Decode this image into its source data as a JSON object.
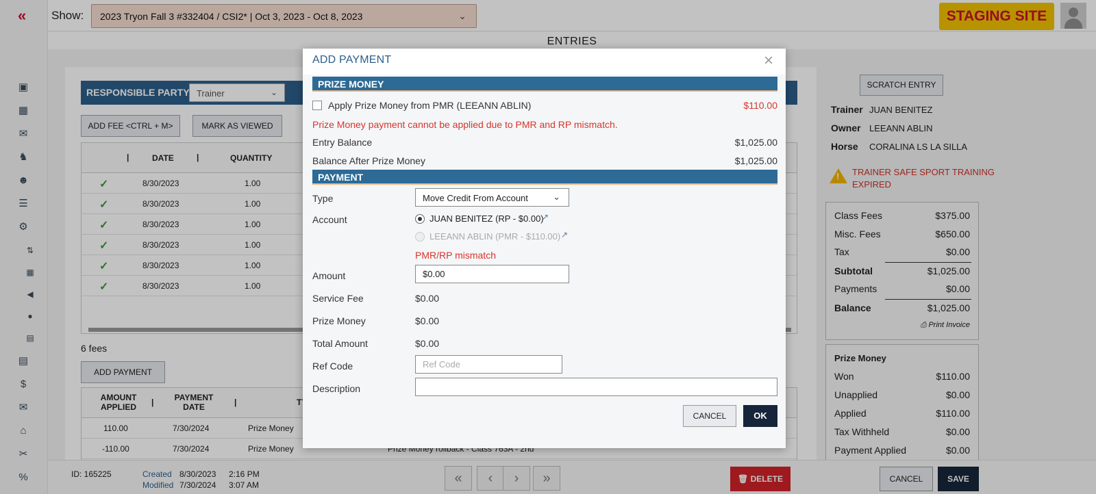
{
  "topbar": {
    "show_label": "Show:",
    "show_value": "2023 Tryon Fall 3 #332404 / CSI2* | Oct 3, 2023 - Oct 8, 2023",
    "staging_label": "STAGING SITE"
  },
  "page": {
    "title": "ENTRIES"
  },
  "background": {
    "rp_label": "RESPONSIBLE PARTY",
    "rp_select": "Trainer",
    "add_fee_button": "ADD FEE <CTRL + M>",
    "mark_viewed_button": "MARK AS VIEWED",
    "grid_headers": [
      "DATE",
      "QUANTITY"
    ],
    "grid_rows": [
      {
        "date": "8/30/2023",
        "qty": "1.00"
      },
      {
        "date": "8/30/2023",
        "qty": "1.00"
      },
      {
        "date": "8/30/2023",
        "qty": "1.00"
      },
      {
        "date": "8/30/2023",
        "qty": "1.00"
      },
      {
        "date": "8/30/2023",
        "qty": "1.00"
      },
      {
        "date": "8/30/2023",
        "qty": "1.00"
      }
    ],
    "fees_count": "6 fees",
    "add_payment_button": "ADD PAYMENT",
    "pay_headers": [
      "AMOUNT APPLIED",
      "PAYMENT DATE",
      "TY"
    ],
    "pay_rows": [
      {
        "amount": "110.00",
        "date": "7/30/2024",
        "type": "Prize Money",
        "desc": ""
      },
      {
        "amount": "-110.00",
        "date": "7/30/2024",
        "type": "Prize Money",
        "desc": "Prize Money rollback - Class 763A - 2nd"
      }
    ],
    "scratch_button": "SCRATCH ENTRY",
    "trainer_label": "Trainer",
    "trainer_value": "JUAN BENITEZ",
    "owner_label": "Owner",
    "owner_value": "LEEANN ABLIN",
    "horse_label": "Horse",
    "horse_value": "CORALINA LS LA SILLA",
    "warning": "TRAINER SAFE SPORT TRAINING EXPIRED",
    "fees_box": [
      {
        "label": "Class Fees",
        "value": "$375.00"
      },
      {
        "label": "Misc. Fees",
        "value": "$650.00"
      },
      {
        "label": "Tax",
        "value": "$0.00"
      },
      {
        "label": "Subtotal",
        "value": "$1,025.00"
      },
      {
        "label": "Payments",
        "value": "$0.00"
      },
      {
        "label": "Balance",
        "value": "$1,025.00"
      }
    ],
    "print_invoice": "Print Invoice",
    "prize_box_title": "Prize Money",
    "prize_box": [
      {
        "label": "Won",
        "value": "$110.00"
      },
      {
        "label": "Unapplied",
        "value": "$0.00"
      },
      {
        "label": "Applied",
        "value": "$110.00"
      },
      {
        "label": "Tax Withheld",
        "value": "$0.00"
      },
      {
        "label": "Payment Applied",
        "value": "$0.00"
      }
    ],
    "footer_id": "ID: 165225",
    "footer_created_label": "Created",
    "footer_created_date": "8/30/2023",
    "footer_created_time": "2:16 PM",
    "footer_modified_label": "Modified",
    "footer_modified_date": "7/30/2024",
    "footer_modified_time": "3:07 AM",
    "delete_button": "DELETE",
    "cancel_button": "CANCEL",
    "save_button": "SAVE"
  },
  "modal": {
    "title": "ADD PAYMENT",
    "prize_section": "PRIZE MONEY",
    "apply_label": "Apply Prize Money from PMR (LEEANN ABLIN)",
    "apply_amount": "$110.00",
    "mismatch_error": "Prize Money payment cannot be applied due to PMR and RP mismatch.",
    "entry_balance_label": "Entry Balance",
    "entry_balance_value": "$1,025.00",
    "balance_after_label": "Balance After Prize Money",
    "balance_after_value": "$1,025.00",
    "payment_section": "PAYMENT",
    "type_label": "Type",
    "type_value": "Move Credit From Account",
    "account_label": "Account",
    "account_option_1": "JUAN BENITEZ (RP - $0.00)",
    "account_option_2": "LEEANN ABLIN (PMR - $110.00)",
    "account_error": "PMR/RP mismatch",
    "amount_label": "Amount",
    "amount_value": "$0.00",
    "service_fee_label": "Service Fee",
    "service_fee_value": "$0.00",
    "prize_money_label": "Prize Money",
    "prize_money_value": "$0.00",
    "total_label": "Total Amount",
    "total_value": "$0.00",
    "ref_code_label": "Ref Code",
    "ref_code_placeholder": "Ref Code",
    "description_label": "Description",
    "description_value": "",
    "cancel_button": "CANCEL",
    "ok_button": "OK"
  },
  "colors": {
    "accent": "#2d6a96",
    "error": "#d9342b",
    "staging": "#f2c200",
    "primary_dark": "#17253a"
  }
}
